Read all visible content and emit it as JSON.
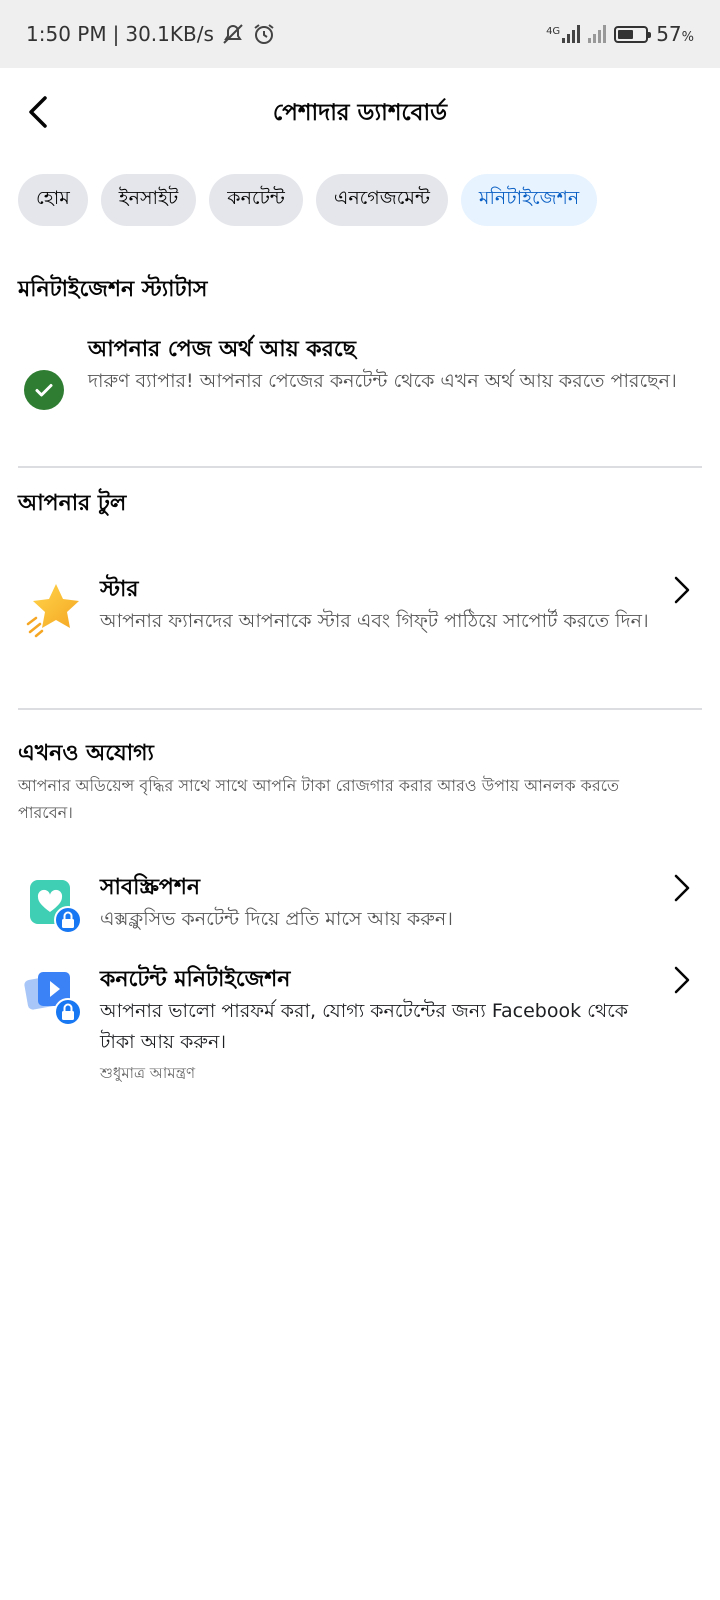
{
  "status_bar": {
    "time": "1:50 PM",
    "speed": "30.1KB/s",
    "network": "4G",
    "battery": "57",
    "battery_unit": "%",
    "battery_level": 0.57
  },
  "header": {
    "title": "পেশাদার ড্যাশবোর্ড"
  },
  "tabs": [
    {
      "label": "হোম",
      "active": false
    },
    {
      "label": "ইনসাইট",
      "active": false
    },
    {
      "label": "কনটেন্ট",
      "active": false
    },
    {
      "label": "এনগেজমেন্ট",
      "active": false
    },
    {
      "label": "মনিটাইজেশন",
      "active": true
    }
  ],
  "status_section": {
    "title": "মনিটাইজেশন স্ট্যাটাস",
    "item_title": "আপনার পেজ অর্থ আয় করছে",
    "item_desc": "দারুণ ব্যাপার! আপনার পেজের কনটেন্ট থেকে এখন অর্থ আয় করতে পারছেন।"
  },
  "tools_section": {
    "title": "আপনার টুল",
    "items": [
      {
        "title": "স্টার",
        "desc": "আপনার ফ্যানদের আপনাকে স্টার এবং গিফ্‌ট পাঠিয়ে সাপোর্ট করতে দিন।",
        "icon": "star-icon"
      }
    ]
  },
  "ineligible_section": {
    "title": "এখনও অযোগ্য",
    "subtitle": "আপনার অডিয়েন্স বৃদ্ধির সাথে সাথে আপনি টাকা রোজগার করার আরও উপায় আনলক করতে পারবেন।",
    "items": [
      {
        "title": "সাবস্ক্রিপশন",
        "desc": "এক্সক্লুসিভ কনটেন্ট দিয়ে প্রতি মাসে আয় করুন।",
        "icon": "subscription-lock-icon"
      },
      {
        "title": "কনটেন্ট মনিটাইজেশন",
        "desc": "আপনার ভালো পারফর্ম করা, যোগ্য কনটেন্টের জন্য Facebook থেকে টাকা আয় করুন।",
        "meta": "শুধুমাত্র আমন্ত্রণ",
        "icon": "content-monetization-lock-icon"
      }
    ]
  },
  "colors": {
    "accent": "#0a5fc4",
    "active_tab_bg": "#e7f3ff",
    "success": "#2e7d32"
  }
}
